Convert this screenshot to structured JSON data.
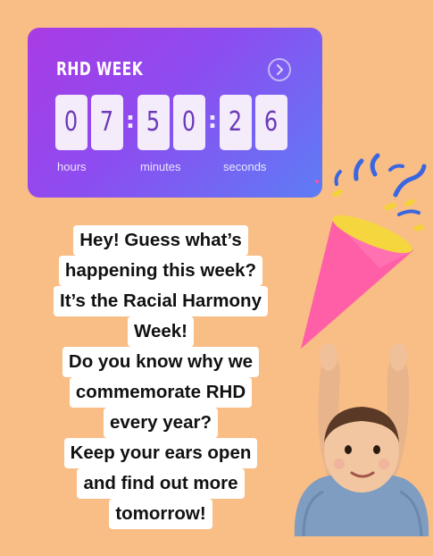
{
  "countdown": {
    "title": "RHD WEEK",
    "digits": [
      "0",
      "7",
      "5",
      "0",
      "2",
      "6"
    ],
    "separator": ":",
    "labels": {
      "hours": "hours",
      "minutes": "minutes",
      "seconds": "seconds"
    },
    "gradient_start": "#a93be4",
    "gradient_end": "#5d7df5",
    "digit_color": "#6c3ab7",
    "icon": "chevron-right-circle-icon"
  },
  "message": {
    "lines": [
      "Hey! Guess what’s",
      "happening this week?",
      "It’s the Racial Harmony",
      "Week!",
      "Do you know why we",
      "commemorate RHD",
      "every year?",
      "Keep your ears open",
      "and find out more",
      "tomorrow!"
    ]
  },
  "stickers": {
    "party_horn": "party-popper-sticker",
    "baby": "clapping-baby-sticker"
  },
  "background_color": "#f9bd86"
}
